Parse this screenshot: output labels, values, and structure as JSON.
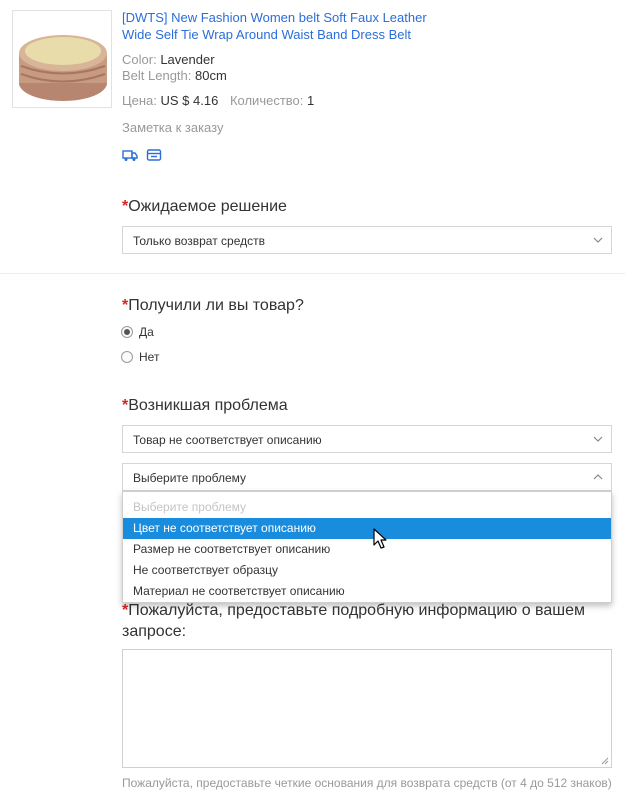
{
  "product": {
    "title": "[DWTS] New Fashion Women belt Soft Faux Leather Wide Self Tie Wrap Around Waist Band Dress Belt",
    "color_label": "Color:",
    "color_value": "Lavender",
    "belt_length_label": "Belt Length:",
    "belt_length_value": "80cm",
    "price_label": "Цена:",
    "price_value": "US $ 4.16",
    "quantity_label": "Количество:",
    "quantity_value": "1",
    "note_link": "Заметка к заказу",
    "icons": [
      "truck-icon",
      "order-card-icon"
    ]
  },
  "expected_solution": {
    "question": "Ожидаемое решение",
    "required_mark": "*",
    "selected": "Только возврат средств"
  },
  "received": {
    "question": "Получили ли вы товар?",
    "required_mark": "*",
    "options": [
      "Да",
      "Нет"
    ],
    "selected_index": 0
  },
  "problem": {
    "question": "Возникшая проблема",
    "required_mark": "*",
    "type_selected": "Товар не соответствует описанию",
    "detail_placeholder": "Выберите проблему",
    "detail_options": [
      "Выберите проблему",
      "Цвет не соответствует описанию",
      "Размер не соответствует описанию",
      "Не соответствует образцу",
      "Материал не соответствует описанию"
    ],
    "highlighted_index": 1
  },
  "details": {
    "question": "Пожалуйста, предоставьте подробную информацию о вашем запросе:",
    "required_mark": "*",
    "value": "",
    "hint": "Пожалуйста, предоставьте четкие основания для возврата средств (от 4 до 512 знаков)"
  },
  "colors": {
    "link": "#2b6ed9",
    "required": "#dd2222",
    "highlight": "#1a8cde"
  }
}
